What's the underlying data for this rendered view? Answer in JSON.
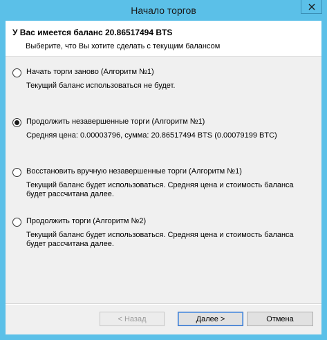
{
  "window": {
    "title": "Начало торгов"
  },
  "header": {
    "title": "У Вас имеется баланс 20.86517494 BTS",
    "subtitle": "Выберите, что Вы хотите сделать с текущим балансом"
  },
  "options": [
    {
      "label": "Начать торги заново (Алгоритм №1)",
      "description": "Текущий баланс использоваться не будет.",
      "selected": false
    },
    {
      "label": "Продолжить незавершенные торги (Алгоритм №1)",
      "description": "Средняя цена: 0.00003796, сумма: 20.86517494 BTS (0.00079199 BTC)",
      "selected": true
    },
    {
      "label": "Восстановить вручную незавершенные торги (Алгоритм №1)",
      "description": "Текущий баланс будет использоваться. Средняя цена и стоимость баланса будет рассчитана далее.",
      "selected": false
    },
    {
      "label": "Продолжить торги (Алгоритм №2)",
      "description": "Текущий баланс будет использоваться. Средняя цена и стоимость баланса будет рассчитана далее.",
      "selected": false
    }
  ],
  "buttons": {
    "back": "< Назад",
    "next": "Далее >",
    "cancel": "Отмена"
  },
  "colors": {
    "frame": "#5bc0e8",
    "client": "#f0f0f0",
    "header": "#ffffff"
  }
}
